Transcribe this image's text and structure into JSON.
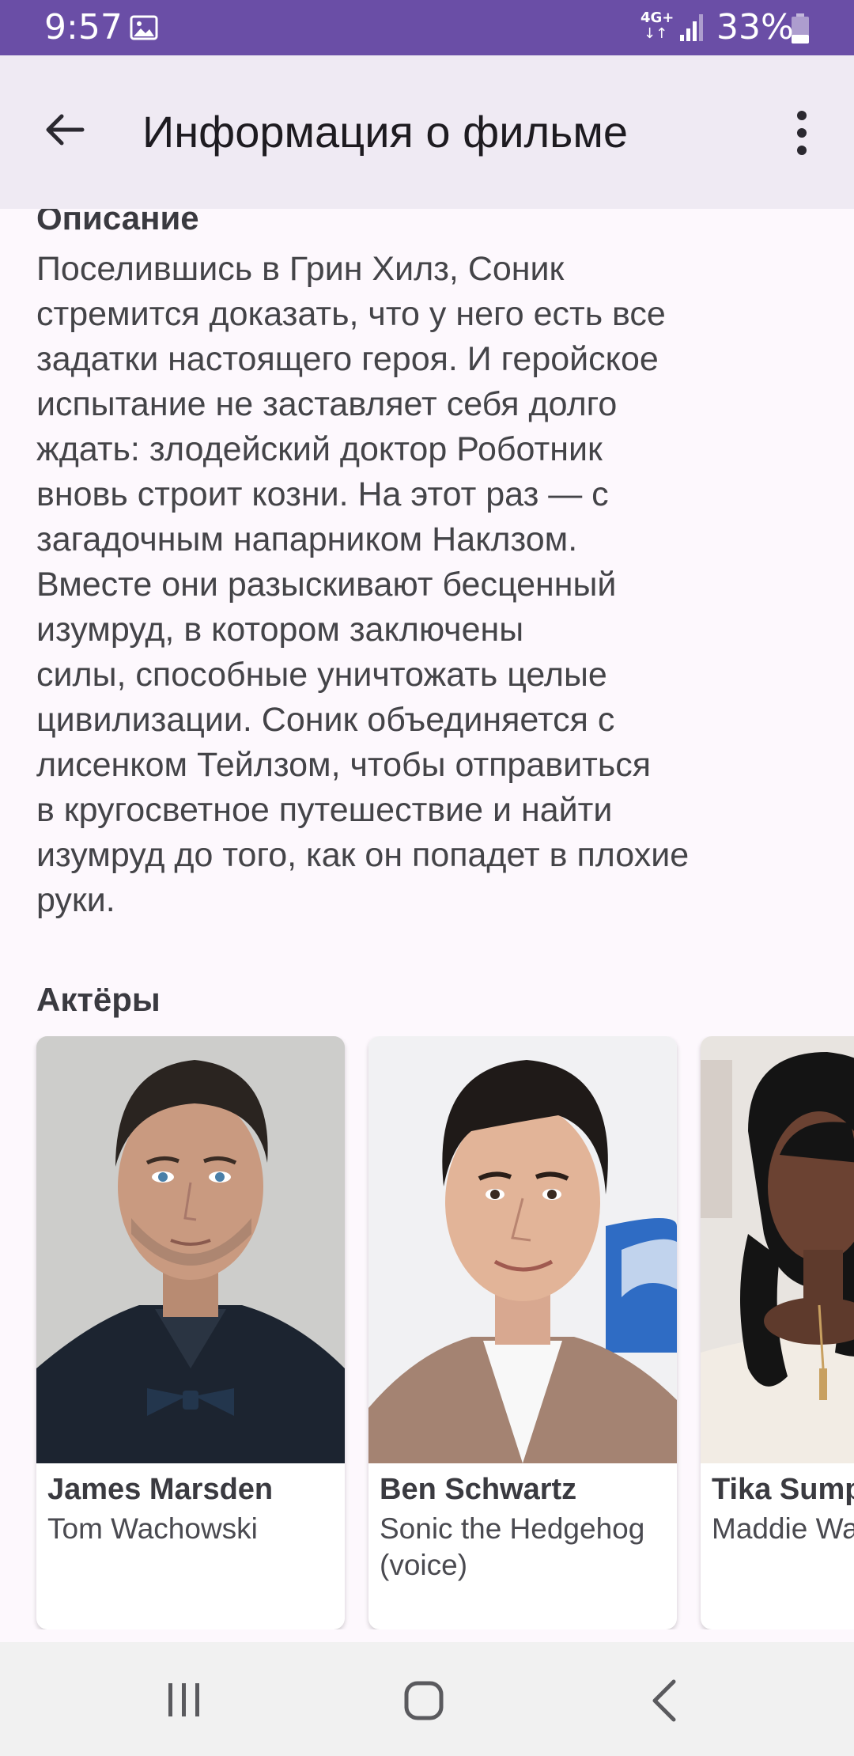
{
  "status_bar": {
    "time": "9:57",
    "network": "4G+",
    "network_arrows": "↓↑",
    "battery": "33%",
    "icons": [
      "gallery-icon",
      "signal-icon",
      "battery-icon"
    ]
  },
  "app_bar": {
    "title": "Информация о фильме",
    "icons": [
      "back-arrow-icon",
      "more-vert-icon"
    ]
  },
  "description": {
    "title": "Описание",
    "lines": [
      "Поселившись в Грин Хилз, Соник",
      "стремится доказать, что у него есть все",
      "задатки настоящего героя. И геройское",
      "испытание не заставляет себя долго",
      "ждать: злодейский доктор Роботник",
      "вновь строит козни. На этот раз — с",
      "загадочным напарником Наклзом.",
      "Вместе они разыскивают бесценный",
      "изумруд, в котором заключены",
      "силы, способные уничтожать целые",
      "цивилизации. Соник объединяется с",
      "лисенком Тейлзом, чтобы отправиться",
      "в кругосветное путешествие и найти",
      "изумруд до того, как он попадет в плохие",
      "руки."
    ]
  },
  "actors": {
    "title": "Актёры",
    "items": [
      {
        "name": "James Marsden",
        "role": "Tom Wachowski"
      },
      {
        "name": "Ben Schwartz",
        "role": "Sonic the Hedgehog (voice)"
      },
      {
        "name": "Tika Sumpter",
        "role": "Maddie Wachowski"
      }
    ]
  },
  "nav_bar": {
    "icons": [
      "recent-apps-icon",
      "home-icon",
      "back-nav-icon"
    ]
  },
  "colors": {
    "status_bar": "#6a4ea6",
    "app_bar": "#efeaf3",
    "background": "#fdf8fd",
    "nav_bar": "#f1f1f1"
  }
}
